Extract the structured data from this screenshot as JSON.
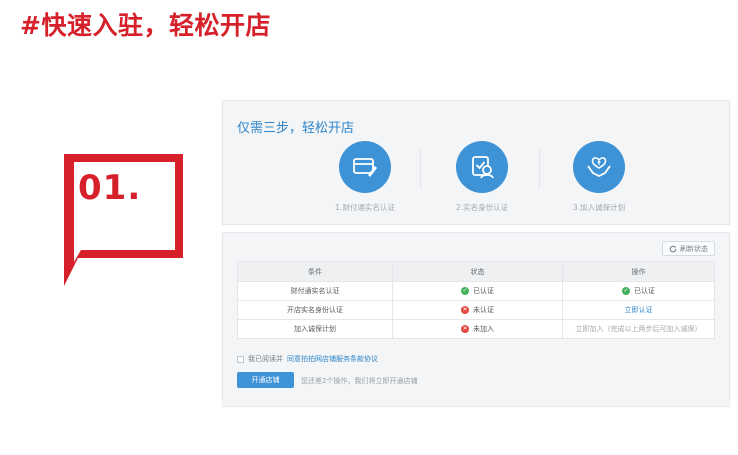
{
  "headline": "#快速入驻，轻松开店",
  "badge": {
    "number": "01.",
    "color": "#d6202a"
  },
  "panel1": {
    "title": "仅需三步，轻松开店",
    "steps": [
      {
        "icon": "id-card-icon",
        "label": "1.财付通实名认证"
      },
      {
        "icon": "id-verify-icon",
        "label": "2.实名身份认证"
      },
      {
        "icon": "hands-heart-icon",
        "label": "3.加入诚保计划"
      }
    ]
  },
  "panel2": {
    "refresh_label": "刷新状态",
    "table": {
      "headers": [
        "条件",
        "状态",
        "操作"
      ],
      "rows": [
        {
          "condition": "财付通实名认证",
          "status": "已认证",
          "status_type": "ok",
          "action": "已认证",
          "action_type": "ok"
        },
        {
          "condition": "开店实名身份认证",
          "status": "未认证",
          "status_type": "err",
          "action": "立即认证",
          "action_type": "link"
        },
        {
          "condition": "加入诚保计划",
          "status": "未加入",
          "status_type": "err",
          "action": "立即加入（完成以上两步后可加入诚保）",
          "action_type": "gray"
        }
      ]
    },
    "agree_prefix": "我已阅读并",
    "agree_link": "同意拍拍网店铺服务条款协议",
    "open_button": "开通店铺",
    "hint": "您还差2个操作，我们将立即开通店铺"
  },
  "colors": {
    "accent_red": "#d6202a",
    "primary_blue": "#3e92d6",
    "success": "#43b15a",
    "error": "#e2463d"
  }
}
